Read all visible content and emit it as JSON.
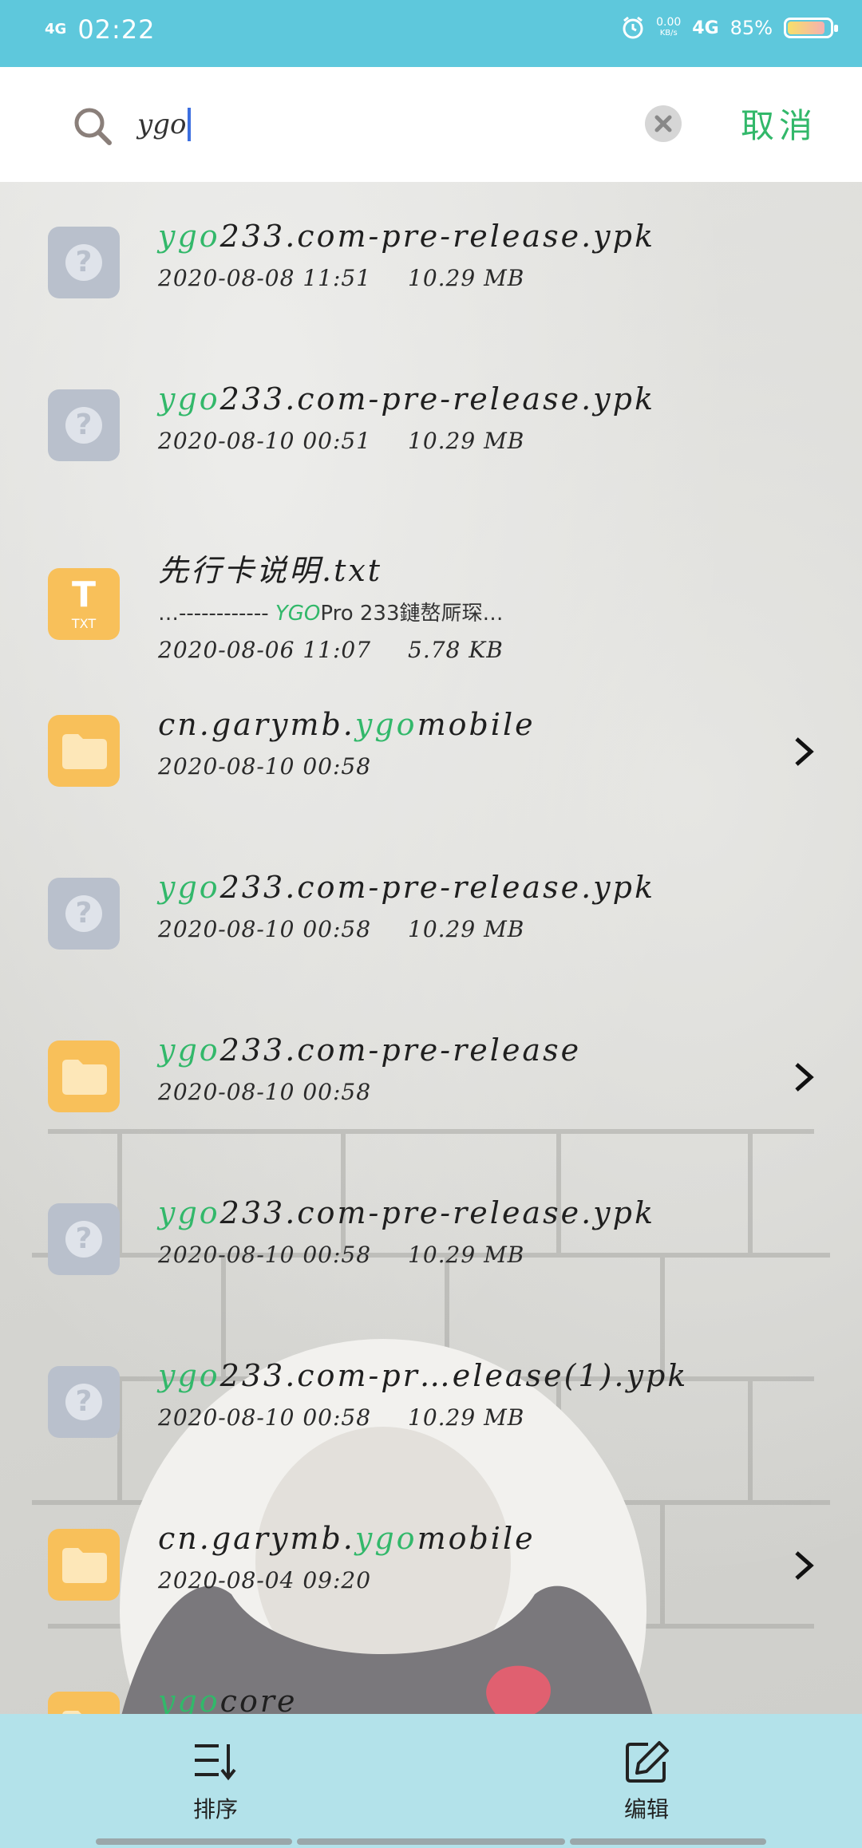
{
  "status_bar": {
    "signal": "4G",
    "time": "02:22",
    "net_speed": "0.00",
    "net_unit": "KB/s",
    "network": "4G",
    "battery": "85%",
    "battery_level": 0.85
  },
  "search": {
    "query": "ygo",
    "cancel_label": "取消"
  },
  "files": [
    {
      "type": "unknown",
      "highlight": "ygo",
      "name_rest": "233.com-pre-release.ypk",
      "date": "2020-08-08 11:51",
      "size": "10.29 MB",
      "is_folder": false
    },
    {
      "type": "unknown",
      "highlight": "ygo",
      "name_rest": "233.com-pre-release.ypk",
      "date": "2020-08-10 00:51",
      "size": "10.29 MB",
      "is_folder": false
    },
    {
      "type": "txt",
      "name": "先行卡说明.txt",
      "preview_before": "…------------ ",
      "preview_highlight": "YGO",
      "preview_after": "Pro 233鏈嶅厛琛…",
      "date": "2020-08-06 11:07",
      "size": "5.78 KB",
      "is_folder": false
    },
    {
      "type": "folder",
      "name_before": "cn.garymb.",
      "highlight": "ygo",
      "name_rest": "mobile",
      "date": "2020-08-10 00:58",
      "is_folder": true
    },
    {
      "type": "unknown",
      "highlight": "ygo",
      "name_rest": "233.com-pre-release.ypk",
      "date": "2020-08-10 00:58",
      "size": "10.29 MB",
      "is_folder": false
    },
    {
      "type": "folder",
      "highlight": "ygo",
      "name_rest": "233.com-pre-release",
      "date": "2020-08-10 00:58",
      "is_folder": true
    },
    {
      "type": "unknown",
      "highlight": "ygo",
      "name_rest": "233.com-pre-release.ypk",
      "date": "2020-08-10 00:58",
      "size": "10.29 MB",
      "is_folder": false
    },
    {
      "type": "unknown",
      "highlight": "ygo",
      "name_rest": "233.com-pr…elease(1).ypk",
      "date": "2020-08-10 00:58",
      "size": "10.29 MB",
      "is_folder": false
    },
    {
      "type": "folder",
      "name_before": "cn.garymb.",
      "highlight": "ygo",
      "name_rest": "mobile",
      "date": "2020-08-04 09:20",
      "is_folder": true
    },
    {
      "type": "folder",
      "highlight": "ygo",
      "name_rest": "core",
      "is_folder": true
    }
  ],
  "bottom_bar": {
    "sort_label": "排序",
    "edit_label": "编辑"
  },
  "colors": {
    "status_bar": "#5ec8dc",
    "highlight": "#32b86a",
    "folder": "#f8c05a",
    "unknown_icon": "#b9c0cc",
    "bottom_bar": "#b3e2ea"
  }
}
